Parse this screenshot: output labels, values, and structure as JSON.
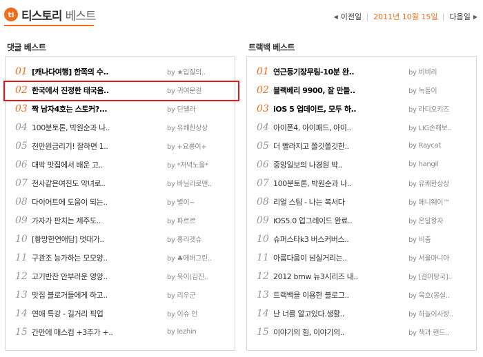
{
  "header": {
    "logo_mark": "ti",
    "logo_name": "티스토리",
    "logo_sub": "베스트",
    "prev_label": "이전일",
    "date": "2011년 10월 15일",
    "next_label": "다음일"
  },
  "comment_best": {
    "title": "댓글 베스트",
    "items": [
      {
        "num": "01",
        "title": "[캐나다여행] 한쪽의 수..",
        "by": "by ★입질의.."
      },
      {
        "num": "02",
        "title": "한국에서 진정한 태국음..",
        "by": "by 귀여운걸"
      },
      {
        "num": "03",
        "title": "짝 남자4호는 스토커?...",
        "by": "by 딘델라"
      },
      {
        "num": "04",
        "title": "100분토론, 박원순과 나..",
        "by": "by 유쾌한상상"
      },
      {
        "num": "05",
        "title": "천만원금리기! 잘하면 1..",
        "by": "by +요롱이+"
      },
      {
        "num": "06",
        "title": "대박 맛집에서 배운 고..",
        "by": "by *저녁노을*"
      },
      {
        "num": "07",
        "title": "천사같은여친도 악녀로..",
        "by": "by 바닐라로맨.."
      },
      {
        "num": "08",
        "title": "다이어트에 도움이 되는..",
        "by": "by 별이~"
      },
      {
        "num": "09",
        "title": "가자가 판치는 제주도..",
        "by": "by 파르르"
      },
      {
        "num": "10",
        "title": "[황망한연애담] 멋대가..",
        "by": "by 홍리겟슈"
      },
      {
        "num": "11",
        "title": "구관조 능가하는 모모양..",
        "by": "by ♣에버그린.."
      },
      {
        "num": "12",
        "title": "고기반찬 안부러운 영양..",
        "by": "by 욱이(김진.."
      },
      {
        "num": "13",
        "title": "맛집 블로거들에게 하고..",
        "by": "by 리우군"
      },
      {
        "num": "14",
        "title": "연애 특강 - 길거리 픽업",
        "by": "by 이슈 인"
      },
      {
        "num": "15",
        "title": "간만에 매스컴 +3추가 +..",
        "by": "by lezhin"
      }
    ]
  },
  "trackback_best": {
    "title": "트랙백 베스트",
    "items": [
      {
        "num": "01",
        "title": "연근등기장무림-10분 완..",
        "by": "by 비비리"
      },
      {
        "num": "02",
        "title": "블랙베리 9900, 잘 만들..",
        "by": "by 늑돌이"
      },
      {
        "num": "03",
        "title": "iOS 5 업데이트, 모두 하..",
        "by": "by 라디오키즈"
      },
      {
        "num": "04",
        "title": "아이폰4, 아이패드, 아이..",
        "by": "by LIG손해보.."
      },
      {
        "num": "05",
        "title": "더 빨라지고 쫄깃쫄깃한..",
        "by": "by Raycat"
      },
      {
        "num": "06",
        "title": "중앙일보의 나경원 박..",
        "by": "by hangil"
      },
      {
        "num": "07",
        "title": "100분토론, 박원순과 나..",
        "by": "by 유쾌한상상"
      },
      {
        "num": "08",
        "title": "리얼 스팀 - 나는 복서다",
        "by": "by 페니웨이™"
      },
      {
        "num": "09",
        "title": "iOS5.0 업그레이드 완료..",
        "by": "by 온달왕자"
      },
      {
        "num": "10",
        "title": "슈퍼스타k3 버스커버스..",
        "by": "by 비춤"
      },
      {
        "num": "11",
        "title": "아름다움이 넘실거리는..",
        "by": "by 서울마니아"
      },
      {
        "num": "12",
        "title": "2012 bmw 뉴3시리즈 내..",
        "by": "by [걸어탕국].."
      },
      {
        "num": "13",
        "title": "트랙백을 이용한 블로그..",
        "by": "by 욱호(몽실.."
      },
      {
        "num": "14",
        "title": "난 너를 알고있다.생활..",
        "by": "by 하늘이사랑.."
      },
      {
        "num": "15",
        "title": "이야기의 힘, 이야기의..",
        "by": "by 책과 핸드.."
      }
    ]
  },
  "colors": {
    "accent": "#f06c1b",
    "highlight_box": "#e41818",
    "border": "#d4d4d4"
  }
}
